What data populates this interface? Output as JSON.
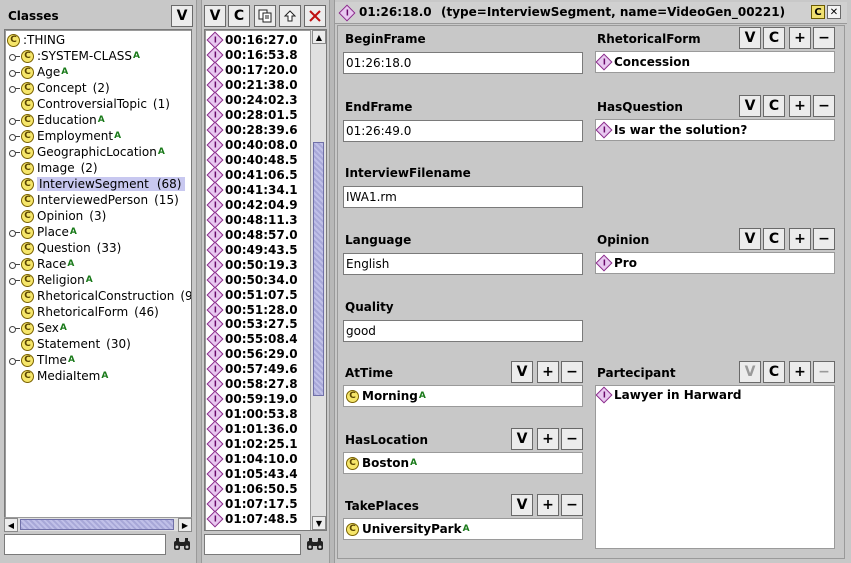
{
  "classes_panel": {
    "title": "Classes",
    "view_button": "V",
    "tree": [
      {
        "label": ":THING",
        "count": "",
        "mark": "",
        "expander": false,
        "indent": 0,
        "selected": false
      },
      {
        "label": ":SYSTEM-CLASS",
        "count": "",
        "mark": "A",
        "expander": true,
        "indent": 1,
        "selected": false
      },
      {
        "label": "Age",
        "count": "",
        "mark": "A",
        "expander": true,
        "indent": 1,
        "selected": false
      },
      {
        "label": "Concept",
        "count": "(2)",
        "mark": "",
        "expander": true,
        "indent": 1,
        "selected": false
      },
      {
        "label": "ControversialTopic",
        "count": "(1)",
        "mark": "",
        "expander": false,
        "indent": 1,
        "selected": false
      },
      {
        "label": "Education",
        "count": "",
        "mark": "A",
        "expander": true,
        "indent": 1,
        "selected": false
      },
      {
        "label": "Employment",
        "count": "",
        "mark": "A",
        "expander": true,
        "indent": 1,
        "selected": false
      },
      {
        "label": "GeographicLocation",
        "count": "",
        "mark": "A",
        "expander": true,
        "indent": 1,
        "selected": false
      },
      {
        "label": "Image",
        "count": "(2)",
        "mark": "",
        "expander": false,
        "indent": 1,
        "selected": false
      },
      {
        "label": "InterviewSegment",
        "count": "(68)",
        "mark": "",
        "expander": false,
        "indent": 1,
        "selected": true
      },
      {
        "label": "InterviewedPerson",
        "count": "(15)",
        "mark": "",
        "expander": false,
        "indent": 1,
        "selected": false
      },
      {
        "label": "Opinion",
        "count": "(3)",
        "mark": "",
        "expander": false,
        "indent": 1,
        "selected": false
      },
      {
        "label": "Place",
        "count": "",
        "mark": "A",
        "expander": true,
        "indent": 1,
        "selected": false
      },
      {
        "label": "Question",
        "count": "(33)",
        "mark": "",
        "expander": false,
        "indent": 1,
        "selected": false
      },
      {
        "label": "Race",
        "count": "",
        "mark": "A",
        "expander": true,
        "indent": 1,
        "selected": false
      },
      {
        "label": "Religion",
        "count": "",
        "mark": "A",
        "expander": true,
        "indent": 1,
        "selected": false
      },
      {
        "label": "RhetoricalConstruction",
        "count": "(9",
        "mark": "",
        "expander": false,
        "indent": 1,
        "selected": false
      },
      {
        "label": "RhetoricalForm",
        "count": "(46)",
        "mark": "",
        "expander": false,
        "indent": 1,
        "selected": false
      },
      {
        "label": "Sex",
        "count": "",
        "mark": "A",
        "expander": true,
        "indent": 1,
        "selected": false
      },
      {
        "label": "Statement",
        "count": "(30)",
        "mark": "",
        "expander": false,
        "indent": 1,
        "selected": false
      },
      {
        "label": "TIme",
        "count": "",
        "mark": "A",
        "expander": true,
        "indent": 1,
        "selected": false
      },
      {
        "label": "MediaItem",
        "count": "",
        "mark": "A",
        "expander": false,
        "indent": 1,
        "selected": false
      }
    ],
    "search_value": ""
  },
  "instances_panel": {
    "buttons": {
      "view": "V",
      "create": "C"
    },
    "items": [
      "00:16:27.0",
      "00:16:53.8",
      "00:17:20.0",
      "00:21:38.0",
      "00:24:02.3",
      "00:28:01.5",
      "00:28:39.6",
      "00:40:08.0",
      "00:40:48.5",
      "00:41:06.5",
      "00:41:34.1",
      "00:42:04.9",
      "00:48:11.3",
      "00:48:57.0",
      "00:49:43.5",
      "00:50:19.3",
      "00:50:34.0",
      "00:51:07.5",
      "00:51:28.0",
      "00:53:27.5",
      "00:55:08.4",
      "00:56:29.0",
      "00:57:49.6",
      "00:58:27.8",
      "00:59:19.0",
      "01:00:53.8",
      "01:01:36.0",
      "01:02:25.1",
      "01:04:10.0",
      "01:05:43.4",
      "01:06:50.5",
      "01:07:17.5",
      "01:07:48.5"
    ],
    "search_value": ""
  },
  "form": {
    "title": "01:26:18.0",
    "subtitle": "(type=InterviewSegment, name=VideoGen_00221)",
    "corner_buttons": {
      "c": "C",
      "x": "✕"
    },
    "begin_frame": {
      "label": "BeginFrame",
      "value": "01:26:18.0"
    },
    "end_frame": {
      "label": "EndFrame",
      "value": "01:26:49.0"
    },
    "interview_filename": {
      "label": "InterviewFilename",
      "value": "IWA1.rm"
    },
    "language": {
      "label": "Language",
      "value": "English"
    },
    "quality": {
      "label": "Quality",
      "value": "good"
    },
    "rhetorical_form": {
      "label": "RhetoricalForm",
      "value": "Concession"
    },
    "has_question": {
      "label": "HasQuestion",
      "value": "Is war the solution?"
    },
    "opinion": {
      "label": "Opinion",
      "value": "Pro"
    },
    "at_time": {
      "label": "AtTime",
      "value": "Morning",
      "mark": "A"
    },
    "has_location": {
      "label": "HasLocation",
      "value": "Boston",
      "mark": "A"
    },
    "take_places": {
      "label": "TakePlaces",
      "value": "UniversityPark",
      "mark": "A"
    },
    "participant": {
      "label": "Partecipant",
      "value": "Lawyer in Harward"
    },
    "btn": {
      "v": "V",
      "c": "C",
      "plus": "+",
      "minus": "−"
    }
  }
}
